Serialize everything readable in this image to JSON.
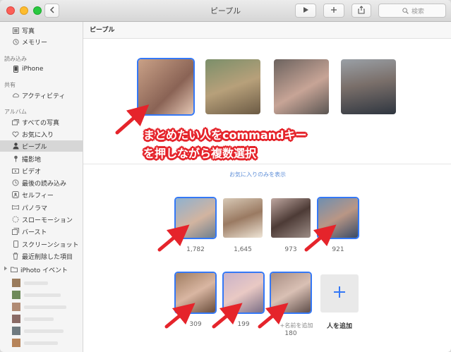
{
  "window": {
    "title": "ピープル"
  },
  "toolbar": {
    "search_placeholder": "検索"
  },
  "sidebar": {
    "top_items": [
      {
        "label": "写真",
        "icon": "photo-grid-icon"
      },
      {
        "label": "メモリー",
        "icon": "memories-icon"
      }
    ],
    "import_header": "読み込み",
    "import_items": [
      {
        "label": "iPhone",
        "icon": "iphone-icon"
      }
    ],
    "shared_header": "共有",
    "shared_items": [
      {
        "label": "アクティビティ",
        "icon": "cloud-icon"
      }
    ],
    "albums_header": "アルバム",
    "album_items": [
      {
        "label": "すべての写真",
        "icon": "photo-stack-icon"
      },
      {
        "label": "お気に入り",
        "icon": "heart-icon"
      },
      {
        "label": "ピープル",
        "icon": "person-icon",
        "selected": true
      },
      {
        "label": "撮影地",
        "icon": "pin-icon"
      },
      {
        "label": "ビデオ",
        "icon": "video-icon"
      },
      {
        "label": "最後の読み込み",
        "icon": "clock-icon"
      },
      {
        "label": "セルフィー",
        "icon": "selfie-icon"
      },
      {
        "label": "パノラマ",
        "icon": "panorama-icon"
      },
      {
        "label": "スローモーション",
        "icon": "slomo-icon"
      },
      {
        "label": "バースト",
        "icon": "burst-icon"
      },
      {
        "label": "スクリーンショット",
        "icon": "screenshot-icon"
      },
      {
        "label": "最近削除した項目",
        "icon": "trash-icon"
      }
    ],
    "iphoto_label": "iPhoto イベント"
  },
  "main": {
    "header": "ピープル",
    "favorites_only_link": "お気に入りのみを表示",
    "people_counts": [
      "1,782",
      "1,645",
      "973",
      "921",
      "309",
      "199",
      "180"
    ],
    "name_hint": "+名前を追加",
    "add_person_label": "人を追加"
  },
  "annotation": {
    "line1": "まとめたい人をcommandキー",
    "line2": "を押しながら複数選択",
    "color": "#e5242b"
  },
  "colors": {
    "selection": "#3478f6",
    "accent_link": "#5f8fd8"
  }
}
